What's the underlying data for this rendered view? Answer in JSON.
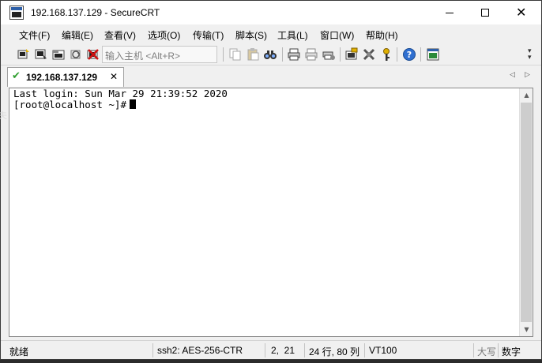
{
  "window": {
    "title": "192.168.137.129 - SecureCRT"
  },
  "menu": [
    {
      "label": "文件(F)"
    },
    {
      "label": "编辑(E)"
    },
    {
      "label": "查看(V)"
    },
    {
      "label": "选项(O)"
    },
    {
      "label": "传输(T)"
    },
    {
      "label": "脚本(S)"
    },
    {
      "label": "工具(L)"
    },
    {
      "label": "窗口(W)"
    },
    {
      "label": "帮助(H)"
    }
  ],
  "toolbar": {
    "command_placeholder": "输入主机 <Alt+R>",
    "icons": [
      "connect-icon",
      "quick-connect-icon",
      "connect-in-tab-icon",
      "reconnect-icon",
      "disconnect-icon",
      "copy-icon",
      "paste-icon",
      "find-icon",
      "print-icon",
      "print-selection-icon",
      "print-setup-icon",
      "session-options-icon",
      "global-options-icon",
      "keymap-icon",
      "help-icon",
      "about-icon"
    ]
  },
  "tab": {
    "label": "192.168.137.129",
    "status_icon": "check-icon"
  },
  "terminal": {
    "lines": [
      "Last login: Sun Mar 29 21:39:52 2020",
      "[root@localhost ~]#"
    ]
  },
  "status": {
    "ready": "就绪",
    "encryption": "ssh2: AES-256-CTR",
    "cursor_pos": "2,  21",
    "dimensions": "24 行, 80 列",
    "emulation": "VT100",
    "caps": "大写",
    "num": "数字"
  },
  "colors": {
    "accent_green": "#2e9e2e",
    "terminal_bg": "#ffffff",
    "terminal_fg": "#000000"
  },
  "side_glyph": "夫"
}
